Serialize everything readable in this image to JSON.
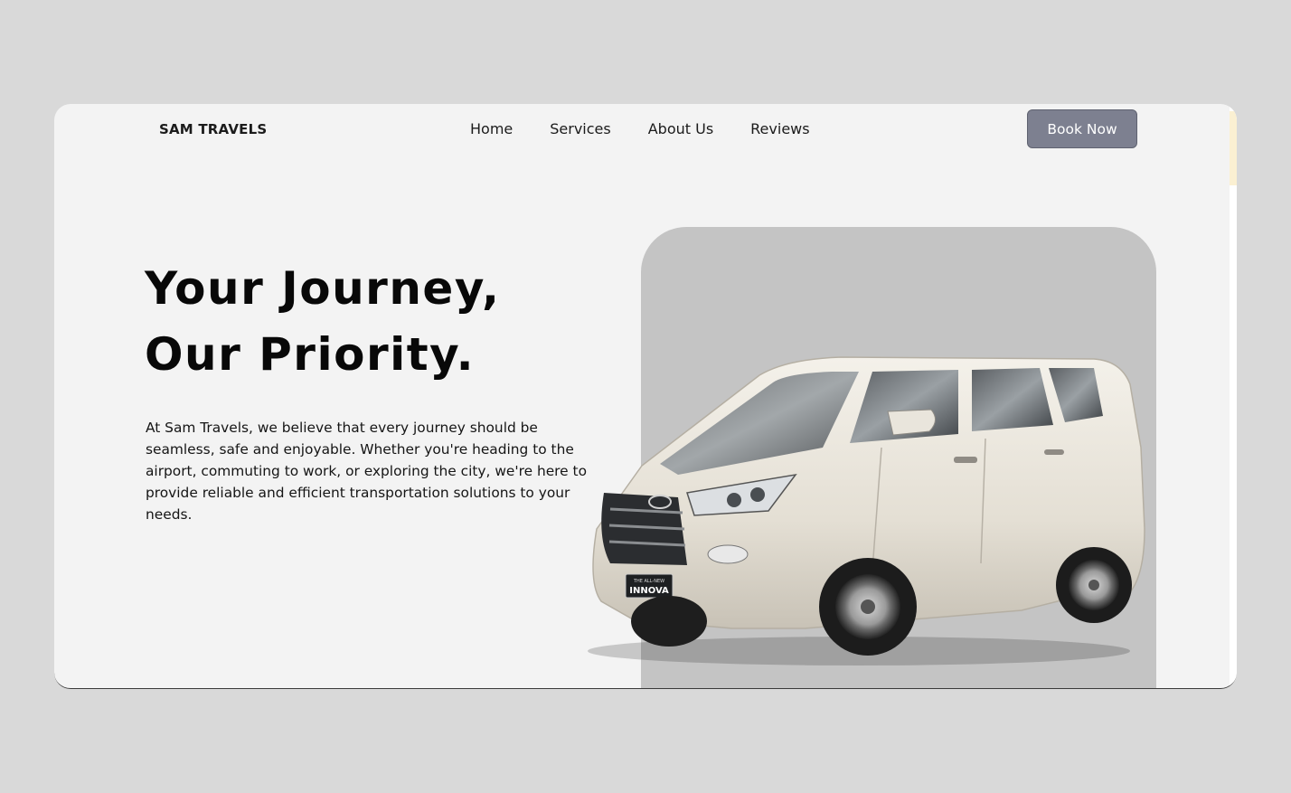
{
  "brand": {
    "name": "SAM TRAVELS"
  },
  "nav": {
    "items": [
      {
        "label": "Home"
      },
      {
        "label": "Services"
      },
      {
        "label": "About Us"
      },
      {
        "label": "Reviews"
      }
    ]
  },
  "cta": {
    "label": "Book Now"
  },
  "hero": {
    "title_line1": "Your Journey,",
    "title_line2": "Our Priority.",
    "description": "At Sam Travels, we believe that every journey should be seamless, safe and enjoyable. Whether you're heading to the airport, commuting to work, or exploring the city, we're here to provide reliable and efficient transportation solutions to your needs.",
    "car_badge_small": "THE ALL-NEW",
    "car_badge": "INNOVA"
  },
  "colors": {
    "page_bg": "#d9d9d9",
    "window_bg": "#f3f3f3",
    "button_bg": "#7d8090",
    "photo_bg": "#c4c4c4"
  },
  "icons": {
    "car_image": "car-photo"
  }
}
